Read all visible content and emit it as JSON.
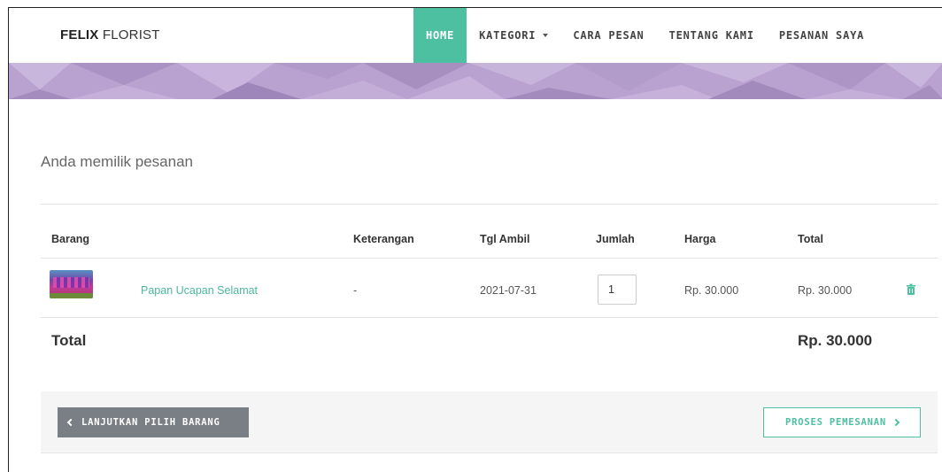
{
  "brand": {
    "bold": "FELIX",
    "rest": " FLORIST"
  },
  "nav": {
    "home": "HOME",
    "kategori": "KATEGORI",
    "cara_pesan": "CARA PESAN",
    "tentang_kami": "TENTANG KAMI",
    "pesanan_saya": "PESANAN SAYA"
  },
  "heading": "Anda memilik pesanan",
  "table": {
    "headers": {
      "barang": "Barang",
      "keterangan": "Keterangan",
      "tgl_ambil": "Tgl Ambil",
      "jumlah": "Jumlah",
      "harga": "Harga",
      "total": "Total"
    },
    "rows": [
      {
        "barang": "Papan Ucapan Selamat",
        "keterangan": "-",
        "tgl_ambil": "2021-07-31",
        "jumlah": "1",
        "harga": "Rp. 30.000",
        "total": "Rp. 30.000"
      }
    ],
    "grand_total_label": "Total",
    "grand_total_value": "Rp. 30.000"
  },
  "buttons": {
    "back": "LANJUTKAN PILIH BARANG",
    "next": "PROSES PEMESANAN"
  },
  "colors": {
    "accent": "#4cc0a0",
    "banner": "#b9a2cf",
    "back_button": "#7a7f85"
  },
  "icons": {
    "dropdown": "caret-down-icon",
    "delete": "trash-icon",
    "back": "chevron-left-icon",
    "next": "chevron-right-icon"
  }
}
